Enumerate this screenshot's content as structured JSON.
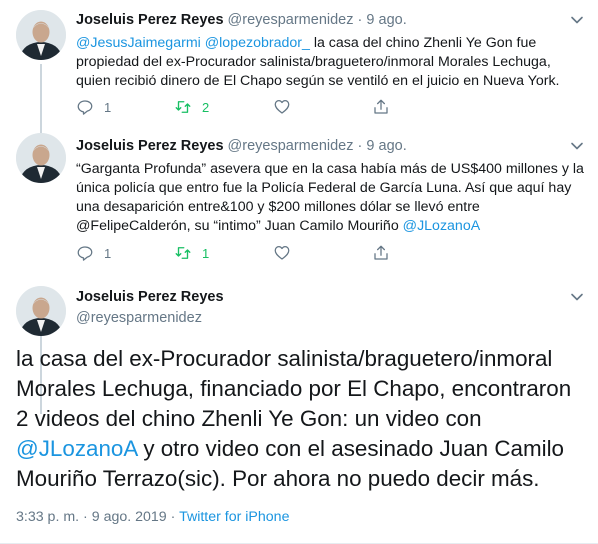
{
  "colors": {
    "text": "#14171a",
    "secondary": "#657786",
    "link": "#1b95e0",
    "retweet": "#17bf63",
    "divider": "#e6ecf0"
  },
  "tweets": [
    {
      "name": "Joseluis Perez Reyes",
      "handle": "@reyesparmenidez",
      "separator": "·",
      "date": "9 ago.",
      "mention1": "@JesusJaimegarmi",
      "mention2": "@lopezobrador_",
      "text": " la casa del chino Zhenli Ye Gon fue propiedad del ex-Procurador salinista/braguetero/inmoral Morales Lechuga, quien recibió dinero de El Chapo según se ventiló en el juicio en Nueva York.",
      "replies": "1",
      "retweets": "2",
      "likes": ""
    },
    {
      "name": "Joseluis Perez Reyes",
      "handle": "@reyesparmenidez",
      "separator": "·",
      "date": "9 ago.",
      "text": "“Garganta Profunda” asevera que en la casa había más de US$400 millones y la única policía que entro fue la Policía Federal de García Luna. Así que aquí hay una desaparición entre&100 y $200 millones dólar se llevó entre @FelipeCalderón, su “intimo” Juan Camilo Mouriño ",
      "mention": "@JLozanoA",
      "replies": "1",
      "retweets": "1",
      "likes": ""
    }
  ],
  "main": {
    "name": "Joseluis Perez Reyes",
    "handle": "@reyesparmenidez",
    "text_part1": "la casa del ex-Procurador salinista/braguetero/inmoral Morales Lechuga, financiado por El Chapo, encontraron 2 videos del chino Zhenli Ye Gon: un video con ",
    "mention": "@JLozanoA",
    "text_part2": " y otro video con el asesinado Juan Camilo Mouriño Terrazo(sic). Por ahora no puedo decir más.",
    "time": "3:33 p. m.",
    "separator": "·",
    "date": "9 ago. 2019",
    "source": "Twitter for iPhone"
  },
  "icons": {
    "avatar": "profile-photo",
    "caret": "chevron-down-icon",
    "reply": "reply-icon",
    "retweet": "retweet-icon",
    "like": "heart-icon",
    "share": "share-icon"
  }
}
